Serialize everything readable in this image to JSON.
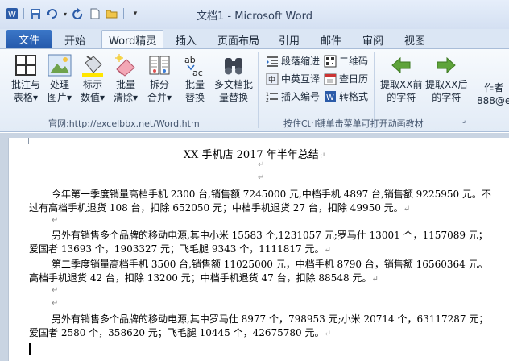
{
  "window": {
    "title": "文档1 - Microsoft Word"
  },
  "tabs": {
    "file": "文件",
    "items": [
      "开始",
      "Word精灵",
      "插入",
      "页面布局",
      "引用",
      "邮件",
      "审阅",
      "视图"
    ]
  },
  "ribbon": {
    "buttons": [
      [
        "批注与",
        "表格▾"
      ],
      [
        "处理",
        "图片▾"
      ],
      [
        "标示",
        "数值▾"
      ],
      [
        "批量",
        "清除▾"
      ],
      [
        "拆分",
        "合并▾"
      ],
      [
        "批量",
        "替换"
      ],
      [
        "多文档批",
        "量替换"
      ],
      [
        "提取XX前",
        "的字符"
      ],
      [
        "提取XX后",
        "的字符"
      ],
      [
        "作者",
        "888@e"
      ]
    ],
    "small_buttons": [
      "段落缩进",
      "中英互译",
      "插入编号",
      "二维码",
      "查日历",
      "转格式"
    ],
    "group_labels": [
      "官网:http://excelbbx.net/Word.htm",
      "按住Ctrl键单击菜单可打开动画教材"
    ]
  },
  "document": {
    "title": "XX 手机店 2017 年半年总结",
    "paragraphs": [
      "今年第一季度销量高档手机 2300 台,销售额 7245000 元,中档手机 4897 台,销售额 9225950 元。不过有高档手机退货 108 台，扣除 652050 元；中档手机退货 27 台，扣除 49950 元。",
      "另外有销售多个品牌的移动电源,其中小米 15583 个,1231057 元;罗马仕 13001 个，1157089 元；爱国者 13693 个，1903327 元；飞毛腿 9343 个，1111817 元。",
      "第二季度销量高档手机 3500 台,销售额 11025000 元，中档手机 8790 台，销售额 16560364 元。高档手机退货 42 台，扣除 13200 元；中档手机退货 47 台，扣除 88548 元。",
      "另外有销售多个品牌的移动电源,其中罗马仕 8977 个，798953 元;小米 20714 个，63117287 元；爱国者 2580 个，358620 元；飞毛腿 10445 个，42675780 元。"
    ],
    "paragraph_mark": "↵"
  }
}
